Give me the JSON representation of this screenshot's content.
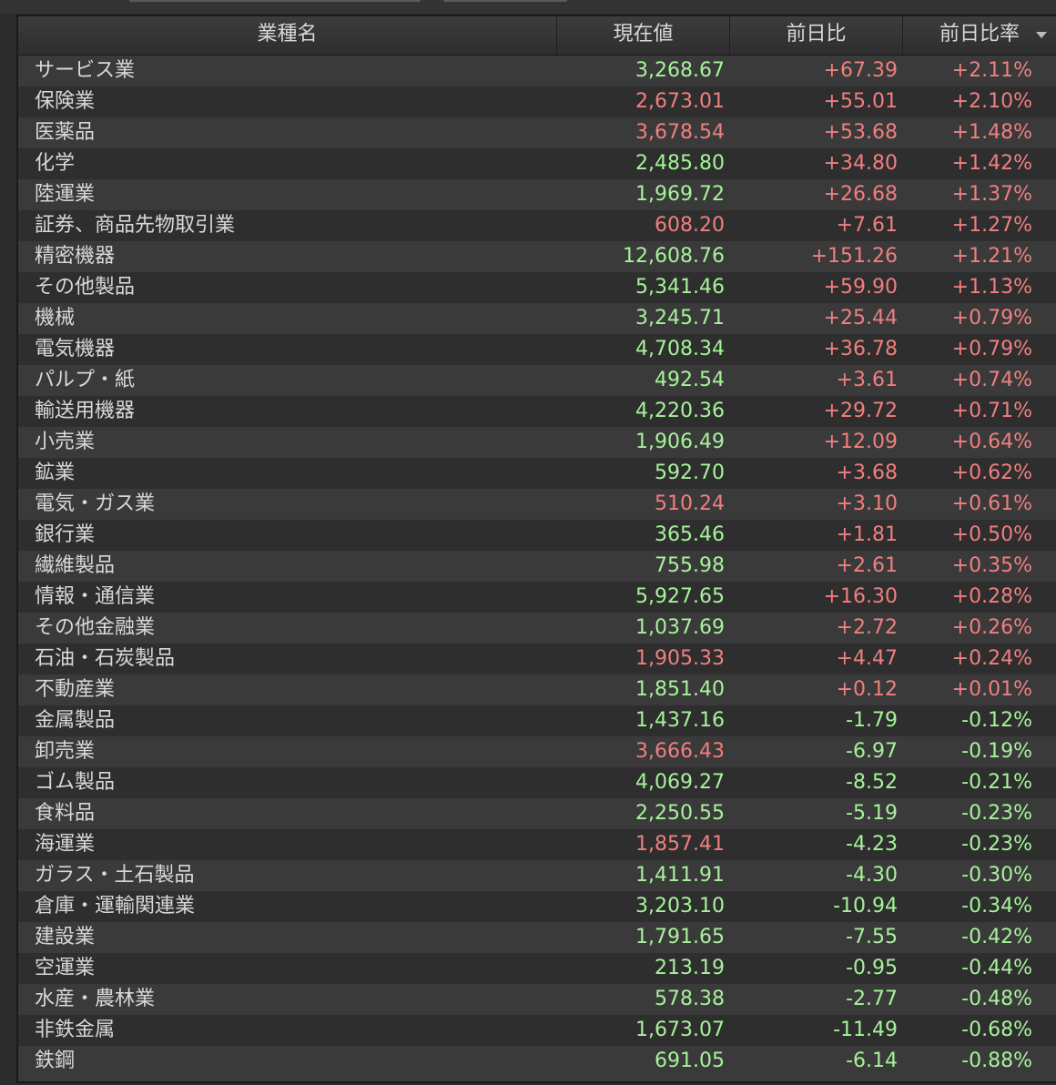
{
  "header": {
    "name": "業種名",
    "price": "現在値",
    "change": "前日比",
    "change_pct": "前日比率"
  },
  "colors": {
    "up": "#f07f7f",
    "down": "#a6f29a",
    "text": "#d8d8d8"
  },
  "rows": [
    {
      "name": "サービス業",
      "price": "3,268.67",
      "price_color": "down",
      "change": "+67.39",
      "change_color": "up",
      "pct": "+2.11%",
      "pct_color": "up"
    },
    {
      "name": "保険業",
      "price": "2,673.01",
      "price_color": "up",
      "change": "+55.01",
      "change_color": "up",
      "pct": "+2.10%",
      "pct_color": "up"
    },
    {
      "name": "医薬品",
      "price": "3,678.54",
      "price_color": "up",
      "change": "+53.68",
      "change_color": "up",
      "pct": "+1.48%",
      "pct_color": "up"
    },
    {
      "name": "化学",
      "price": "2,485.80",
      "price_color": "down",
      "change": "+34.80",
      "change_color": "up",
      "pct": "+1.42%",
      "pct_color": "up"
    },
    {
      "name": "陸運業",
      "price": "1,969.72",
      "price_color": "down",
      "change": "+26.68",
      "change_color": "up",
      "pct": "+1.37%",
      "pct_color": "up"
    },
    {
      "name": "証券、商品先物取引業",
      "price": "608.20",
      "price_color": "up",
      "change": "+7.61",
      "change_color": "up",
      "pct": "+1.27%",
      "pct_color": "up"
    },
    {
      "name": "精密機器",
      "price": "12,608.76",
      "price_color": "down",
      "change": "+151.26",
      "change_color": "up",
      "pct": "+1.21%",
      "pct_color": "up"
    },
    {
      "name": "その他製品",
      "price": "5,341.46",
      "price_color": "down",
      "change": "+59.90",
      "change_color": "up",
      "pct": "+1.13%",
      "pct_color": "up"
    },
    {
      "name": "機械",
      "price": "3,245.71",
      "price_color": "down",
      "change": "+25.44",
      "change_color": "up",
      "pct": "+0.79%",
      "pct_color": "up"
    },
    {
      "name": "電気機器",
      "price": "4,708.34",
      "price_color": "down",
      "change": "+36.78",
      "change_color": "up",
      "pct": "+0.79%",
      "pct_color": "up"
    },
    {
      "name": "パルプ・紙",
      "price": "492.54",
      "price_color": "down",
      "change": "+3.61",
      "change_color": "up",
      "pct": "+0.74%",
      "pct_color": "up"
    },
    {
      "name": "輸送用機器",
      "price": "4,220.36",
      "price_color": "down",
      "change": "+29.72",
      "change_color": "up",
      "pct": "+0.71%",
      "pct_color": "up"
    },
    {
      "name": "小売業",
      "price": "1,906.49",
      "price_color": "down",
      "change": "+12.09",
      "change_color": "up",
      "pct": "+0.64%",
      "pct_color": "up"
    },
    {
      "name": "鉱業",
      "price": "592.70",
      "price_color": "down",
      "change": "+3.68",
      "change_color": "up",
      "pct": "+0.62%",
      "pct_color": "up"
    },
    {
      "name": "電気・ガス業",
      "price": "510.24",
      "price_color": "up",
      "change": "+3.10",
      "change_color": "up",
      "pct": "+0.61%",
      "pct_color": "up"
    },
    {
      "name": "銀行業",
      "price": "365.46",
      "price_color": "down",
      "change": "+1.81",
      "change_color": "up",
      "pct": "+0.50%",
      "pct_color": "up"
    },
    {
      "name": "繊維製品",
      "price": "755.98",
      "price_color": "down",
      "change": "+2.61",
      "change_color": "up",
      "pct": "+0.35%",
      "pct_color": "up"
    },
    {
      "name": "情報・通信業",
      "price": "5,927.65",
      "price_color": "down",
      "change": "+16.30",
      "change_color": "up",
      "pct": "+0.28%",
      "pct_color": "up"
    },
    {
      "name": "その他金融業",
      "price": "1,037.69",
      "price_color": "down",
      "change": "+2.72",
      "change_color": "up",
      "pct": "+0.26%",
      "pct_color": "up"
    },
    {
      "name": "石油・石炭製品",
      "price": "1,905.33",
      "price_color": "up",
      "change": "+4.47",
      "change_color": "up",
      "pct": "+0.24%",
      "pct_color": "up"
    },
    {
      "name": "不動産業",
      "price": "1,851.40",
      "price_color": "down",
      "change": "+0.12",
      "change_color": "up",
      "pct": "+0.01%",
      "pct_color": "up"
    },
    {
      "name": "金属製品",
      "price": "1,437.16",
      "price_color": "down",
      "change": "-1.79",
      "change_color": "down",
      "pct": "-0.12%",
      "pct_color": "down"
    },
    {
      "name": "卸売業",
      "price": "3,666.43",
      "price_color": "up",
      "change": "-6.97",
      "change_color": "down",
      "pct": "-0.19%",
      "pct_color": "down"
    },
    {
      "name": "ゴム製品",
      "price": "4,069.27",
      "price_color": "down",
      "change": "-8.52",
      "change_color": "down",
      "pct": "-0.21%",
      "pct_color": "down"
    },
    {
      "name": "食料品",
      "price": "2,250.55",
      "price_color": "down",
      "change": "-5.19",
      "change_color": "down",
      "pct": "-0.23%",
      "pct_color": "down"
    },
    {
      "name": "海運業",
      "price": "1,857.41",
      "price_color": "up",
      "change": "-4.23",
      "change_color": "down",
      "pct": "-0.23%",
      "pct_color": "down"
    },
    {
      "name": "ガラス・土石製品",
      "price": "1,411.91",
      "price_color": "down",
      "change": "-4.30",
      "change_color": "down",
      "pct": "-0.30%",
      "pct_color": "down"
    },
    {
      "name": "倉庫・運輸関連業",
      "price": "3,203.10",
      "price_color": "down",
      "change": "-10.94",
      "change_color": "down",
      "pct": "-0.34%",
      "pct_color": "down"
    },
    {
      "name": "建設業",
      "price": "1,791.65",
      "price_color": "down",
      "change": "-7.55",
      "change_color": "down",
      "pct": "-0.42%",
      "pct_color": "down"
    },
    {
      "name": "空運業",
      "price": "213.19",
      "price_color": "down",
      "change": "-0.95",
      "change_color": "down",
      "pct": "-0.44%",
      "pct_color": "down"
    },
    {
      "name": "水産・農林業",
      "price": "578.38",
      "price_color": "down",
      "change": "-2.77",
      "change_color": "down",
      "pct": "-0.48%",
      "pct_color": "down"
    },
    {
      "name": "非鉄金属",
      "price": "1,673.07",
      "price_color": "down",
      "change": "-11.49",
      "change_color": "down",
      "pct": "-0.68%",
      "pct_color": "down"
    },
    {
      "name": "鉄鋼",
      "price": "691.05",
      "price_color": "down",
      "change": "-6.14",
      "change_color": "down",
      "pct": "-0.88%",
      "pct_color": "down"
    }
  ]
}
